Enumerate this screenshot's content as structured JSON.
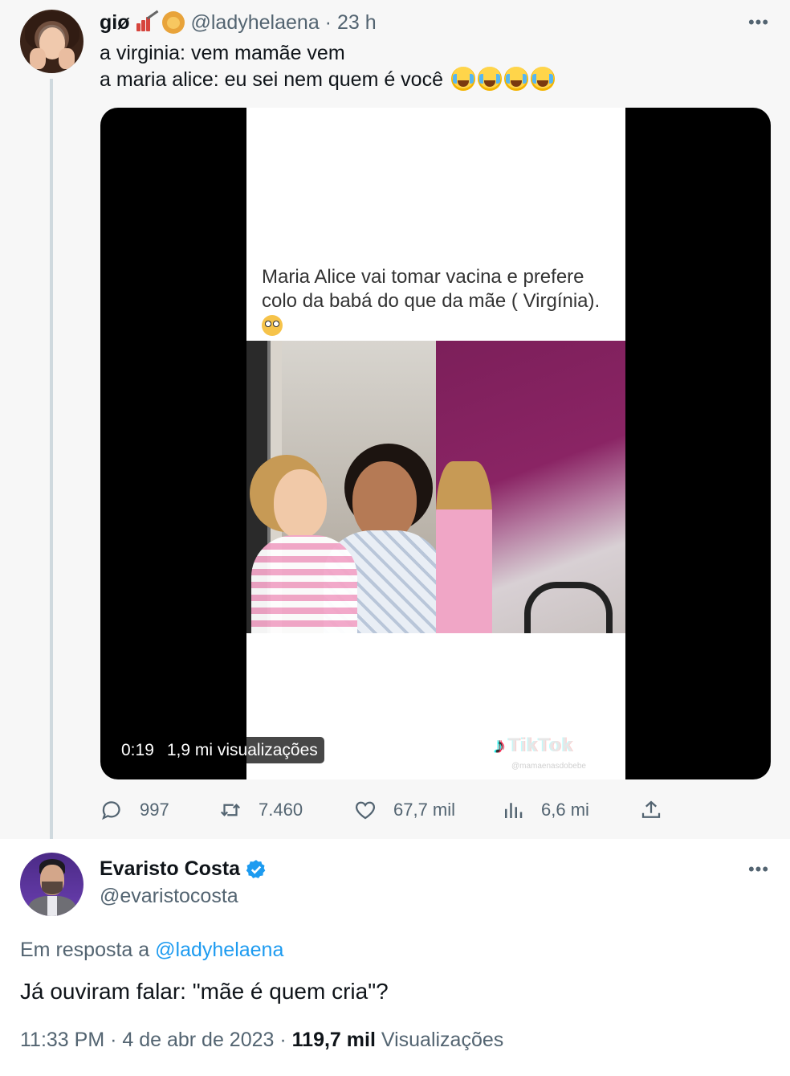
{
  "tweet1": {
    "author_name": "giø",
    "author_emojis": [
      "chart-with-red-bars-icon",
      "lion-face-icon"
    ],
    "handle": "@ladyhelaena",
    "separator": "·",
    "time": "23 h",
    "more": "•••",
    "text_line1": "a virginia: vem mamãe vem",
    "text_line2": "a maria alice: eu sei nem quem é você",
    "text_emojis": [
      "crying-face-icon",
      "crying-face-icon",
      "crying-face-icon",
      "crying-face-icon"
    ],
    "media": {
      "caption": "Maria Alice vai tomar  vacina e prefere colo da babá do que da mãe ( Virgínia).",
      "caption_emoji": "flushed-face-icon",
      "watermark": "TikTok",
      "watermark_sub": "@mamaenasdobebe",
      "duration": "0:19",
      "views": "1,9 mi visualizações"
    },
    "actions": {
      "replies": "997",
      "retweets": "7.460",
      "likes": "67,7 mil",
      "views": "6,6 mi"
    }
  },
  "tweet2": {
    "author_name": "Evaristo Costa",
    "verified": true,
    "handle": "@evaristocosta",
    "more": "•••",
    "reply_prefix": "Em resposta a",
    "reply_to": "@ladyhelaena",
    "text": "Já ouviram falar: \"mãe é quem cria\"?",
    "time": "11:33 PM",
    "date": "4 de abr de 2023",
    "views_count": "119,7 mil",
    "views_label": "Visualizações"
  },
  "colors": {
    "accent": "#1d9bf0",
    "muted": "#536471",
    "text": "#0f1419",
    "parent_bg": "#f7f7f7"
  }
}
